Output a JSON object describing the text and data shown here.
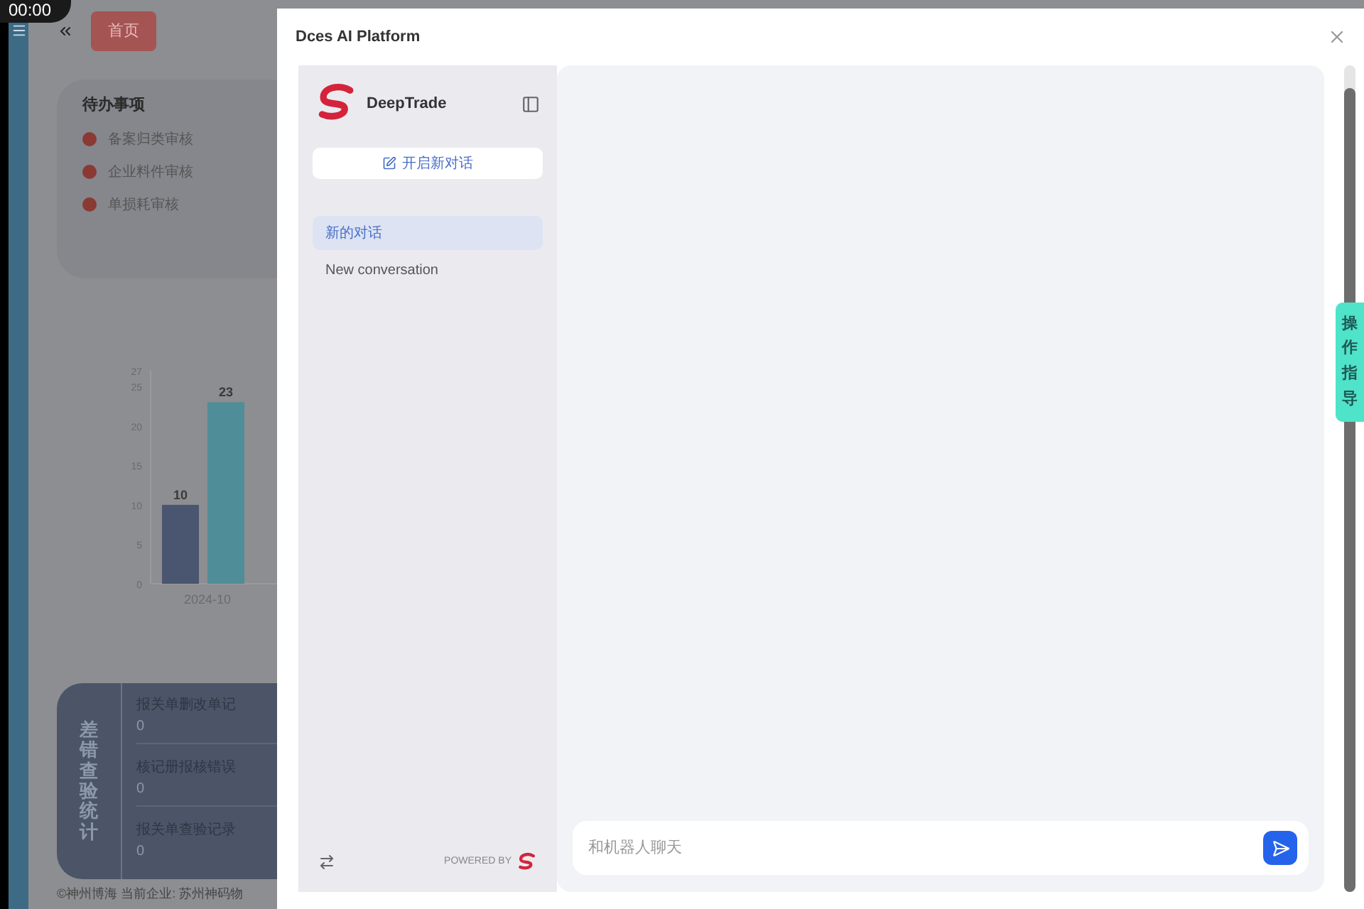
{
  "timer": "00:00",
  "background_page": {
    "home_button": "首页",
    "todo": {
      "title": "待办事项",
      "items": [
        "备案归类审核",
        "企业料件审核",
        "单损耗审核"
      ]
    },
    "chart_data": {
      "type": "bar",
      "categories": [
        "2024-10"
      ],
      "yticks": [
        0,
        5,
        10,
        15,
        20,
        25,
        27
      ],
      "ylim": [
        0,
        27
      ],
      "data_labels": true,
      "series": [
        {
          "color": "#4a5670",
          "values": [
            10
          ]
        },
        {
          "color": "#4f8d98",
          "values": [
            23
          ]
        }
      ]
    },
    "stats": {
      "title": "差错查验统计",
      "rows": [
        {
          "label": "报关单删改单记",
          "value": "0"
        },
        {
          "label": "核记册报核错误",
          "value": "0"
        },
        {
          "label": "报关单查验记录",
          "value": "0"
        }
      ]
    },
    "footer": "©神州博海 当前企业: 苏州神码物"
  },
  "modal": {
    "title": "Dces AI Platform",
    "sidebar": {
      "brand": "DeepTrade",
      "new_chat_button": "开启新对话",
      "conversations": [
        {
          "label": "新的对话",
          "selected": true
        },
        {
          "label": "New conversation",
          "selected": false
        }
      ],
      "powered_by": "POWERED BY"
    },
    "chat": {
      "placeholder": "和机器人聊天"
    }
  },
  "side_tab": "操作指导"
}
